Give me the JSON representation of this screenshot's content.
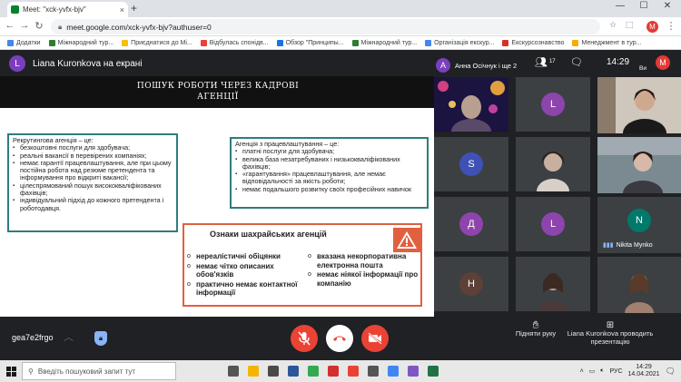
{
  "browser": {
    "tab_title": "Meet: \"xck-yvfx-bjv\"",
    "tab_close": "×",
    "new_tab": "+",
    "window_controls": [
      "—",
      "☐",
      "✕"
    ],
    "url": "meet.google.com/xck-yvfx-bjv?authuser=0",
    "profile_initial": "M",
    "bookmarks": [
      {
        "label": "Додатки",
        "color": "#4285f4"
      },
      {
        "label": "Міжнародний тур...",
        "color": "#2e7d32"
      },
      {
        "label": "Приєднатися до Мі...",
        "color": "#fbbc04"
      },
      {
        "label": "Відбулась спонідв...",
        "color": "#ea4335"
      },
      {
        "label": "Обзор \"Принципы...",
        "color": "#1a73e8"
      },
      {
        "label": "Міжнародний тур...",
        "color": "#2e7d32"
      },
      {
        "label": "Організація екскур...",
        "color": "#4285f4"
      },
      {
        "label": "Екскурсознавство",
        "color": "#d93025"
      },
      {
        "label": "Менеджмент в тур...",
        "color": "#f9ab00"
      }
    ]
  },
  "meet": {
    "presenter_initial": "L",
    "presenter_title": "Liana Kuronkova на екрані",
    "speaker_name": "Анна Осічнук і ще 2",
    "speaker_initial": "A",
    "participants_count": "17",
    "time": "14:29",
    "you_label": "Ви",
    "self_initial": "M",
    "meeting_code": "gea7e2frgo",
    "raise_hand_label": "Підняти руку",
    "presenting_label": "Liana Kuronkova проводить презентацію",
    "tiles": [
      {
        "initial": "L",
        "color": "#8e44ad"
      },
      {
        "initial": "S",
        "color": "#3f51b5"
      },
      {
        "initial": "Д",
        "color": "#8e44ad"
      },
      {
        "initial": "L",
        "color": "#8e44ad"
      },
      {
        "initial": "N",
        "color": "#00796b",
        "name": "Nikita Mynko"
      },
      {
        "initial": "Н",
        "color": "#5d4037"
      }
    ]
  },
  "slide": {
    "title_line1": "ПОШУК РОБОТИ ЧЕРЕЗ КАДРОВІ",
    "title_line2": "АГЕНЦІЇ",
    "recruit_heading": "Рекрутингова агенція – це:",
    "recruit_items": [
      "безкоштовні послуги для здобувача;",
      "реальні вакансії в перевірених компаніях;",
      "немає гарантії працевлаштування, але при цьому постійна робота над резюме претендента та інформування про відкриті вакансії;",
      "цілеспрямований пошук висококваліфікованих фахівців;",
      "індивідуальний підхід до кожного претендента і роботодавця."
    ],
    "agency_heading": "Агенція з працевлаштування – це:",
    "agency_items": [
      "платні послуги для здобувача;",
      "велика база незатребуваних і низькокваліфікованих фахівців;",
      "«гарантування» працевлаштування, але немає відповідальності за якість роботи;",
      "немає подальшого розвитку своїх професійних навичок"
    ],
    "fraud_title": "Ознаки шахрайських  агенцій",
    "fraud_left": [
      "нереалістичні обіцянки",
      "немає чітко описаних обов'язків",
      "практично немає контактної інформації"
    ],
    "fraud_right": [
      "вказана некорпоративна електронна пошта",
      "немає ніякої інформації про компанію"
    ]
  },
  "taskbar": {
    "search_placeholder": "Введіть пошуковий запит тут",
    "lang": "РУС",
    "time": "14:29",
    "date": "14.04.2021",
    "apps": [
      {
        "name": "task-view-icon",
        "color": "#555555"
      },
      {
        "name": "explorer-icon",
        "color": "#f4b400"
      },
      {
        "name": "store-icon",
        "color": "#4a4a4a"
      },
      {
        "name": "word-icon",
        "color": "#2b579a"
      },
      {
        "name": "chrome-icon",
        "color": "#34a853"
      },
      {
        "name": "opera-icon",
        "color": "#d32f2f"
      },
      {
        "name": "chrome-badge-icon",
        "color": "#ea4335"
      },
      {
        "name": "yandex-icon",
        "color": "#555555"
      },
      {
        "name": "chrome-profile-icon",
        "color": "#4285f4"
      },
      {
        "name": "viber-icon",
        "color": "#7e57c2"
      },
      {
        "name": "excel-icon",
        "color": "#217346"
      }
    ]
  }
}
